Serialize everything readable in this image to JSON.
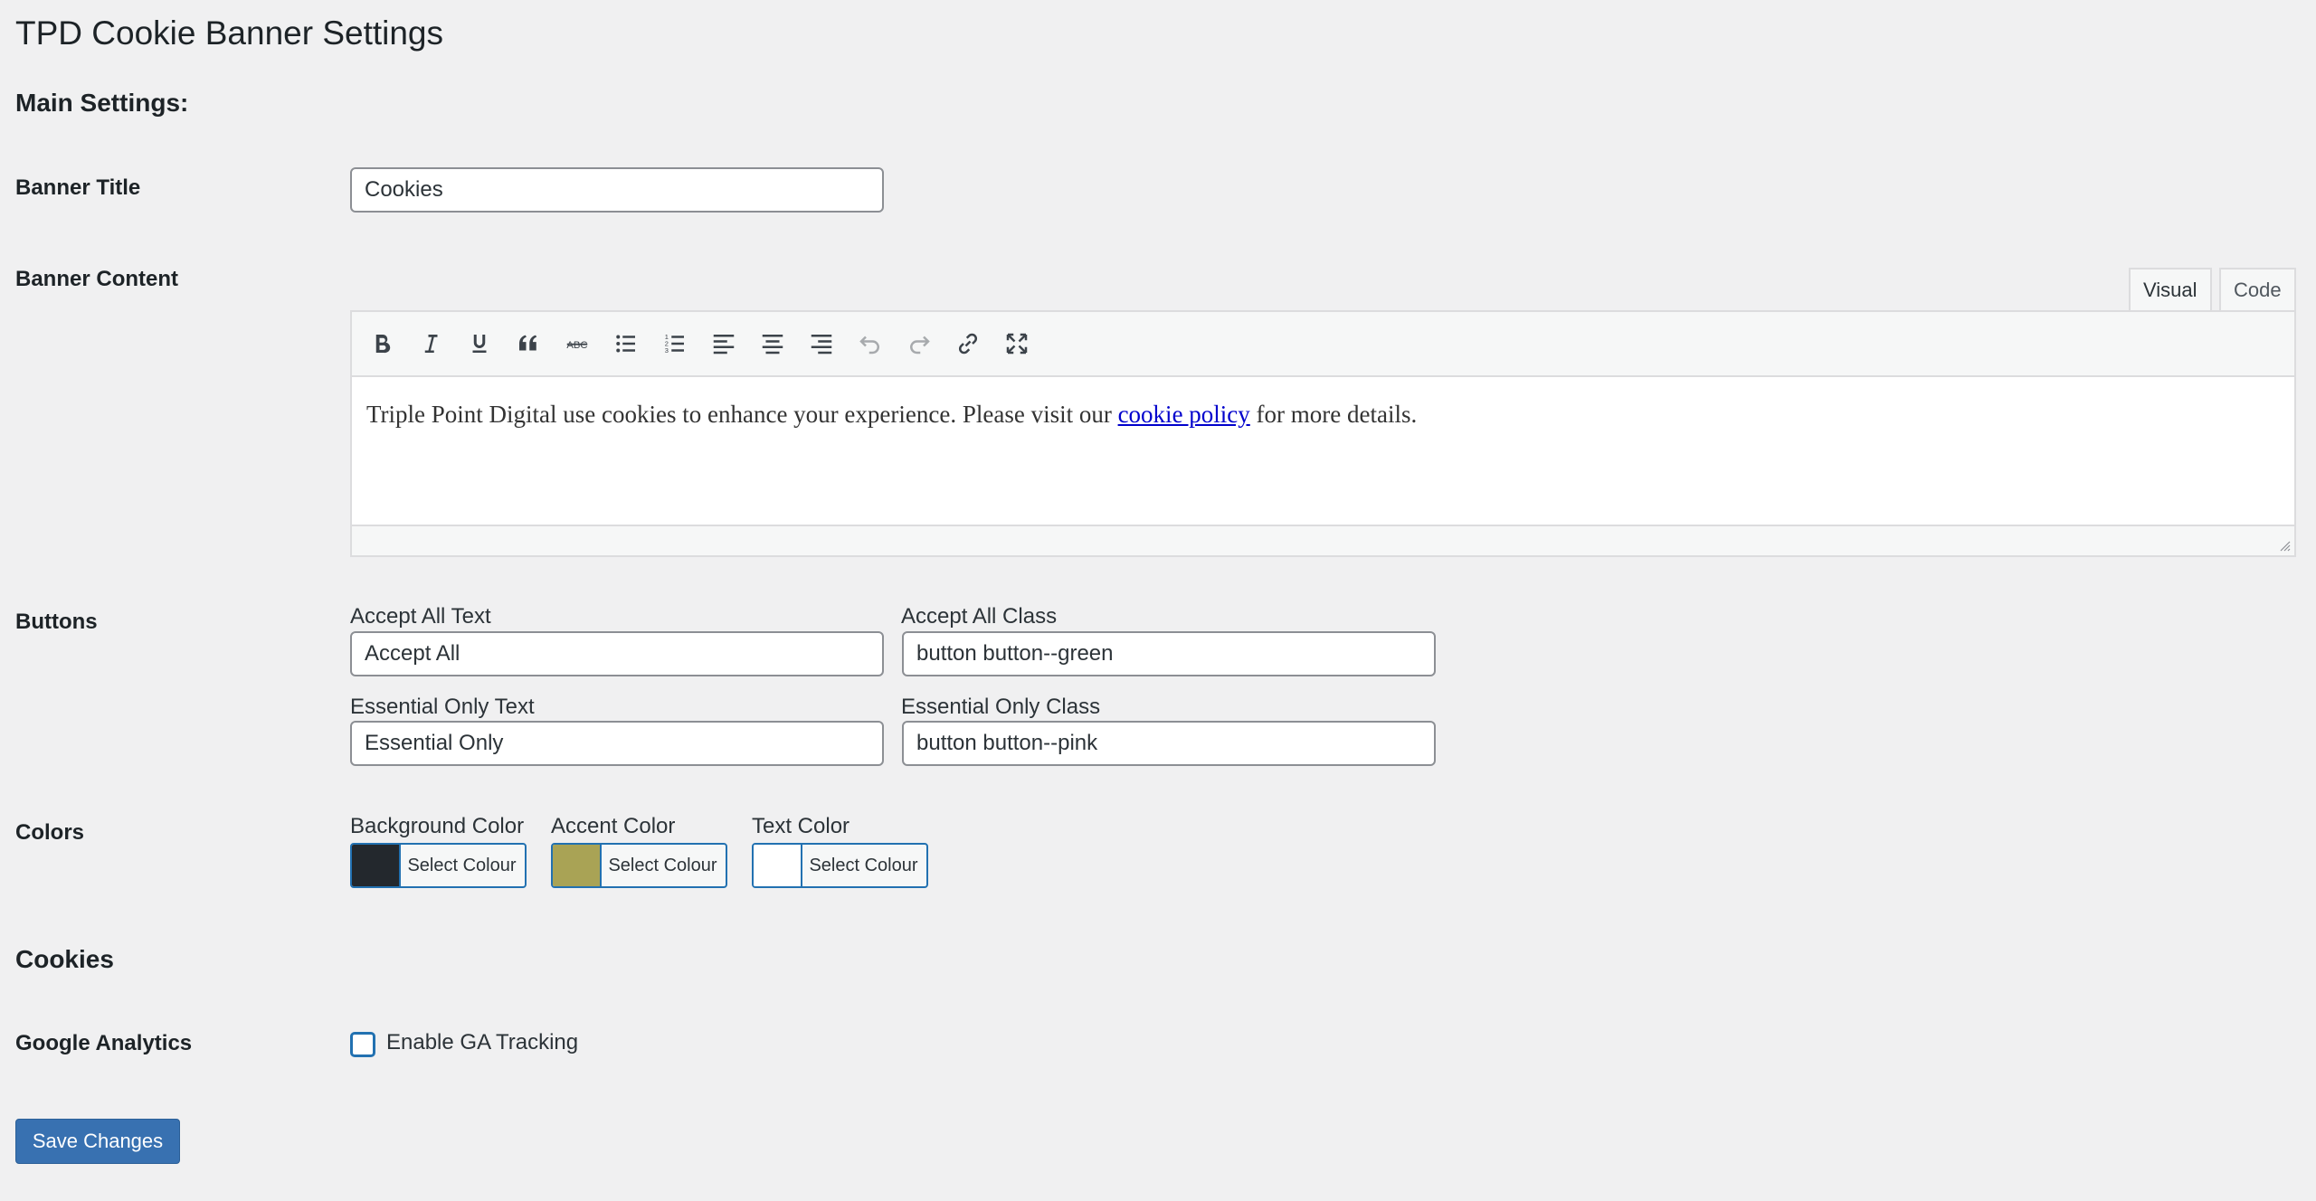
{
  "page": {
    "title": "TPD Cookie Banner Settings",
    "main_settings_heading": "Main Settings:",
    "cookies_heading": "Cookies"
  },
  "banner_title": {
    "label": "Banner Title",
    "value": "Cookies"
  },
  "banner_content": {
    "label": "Banner Content",
    "tabs": [
      "Visual",
      "Code"
    ],
    "active_tab": "Visual",
    "toolbar": [
      "bold-icon",
      "italic-icon",
      "underline-icon",
      "blockquote-icon",
      "strikethrough-icon",
      "bullet-list-icon",
      "numbered-list-icon",
      "align-left-icon",
      "align-center-icon",
      "align-right-icon",
      "undo-icon",
      "redo-icon",
      "link-icon",
      "fullscreen-icon"
    ],
    "text_before": "Triple Point Digital use cookies to enhance your experience. Please visit our ",
    "link_text": "cookie policy",
    "text_after": " for more details."
  },
  "buttons": {
    "label": "Buttons",
    "accept_all_text_label": "Accept All Text",
    "accept_all_text_value": "Accept All",
    "accept_all_class_label": "Accept All Class",
    "accept_all_class_value": "button button--green",
    "essential_only_text_label": "Essential Only Text",
    "essential_only_text_value": "Essential Only",
    "essential_only_class_label": "Essential Only Class",
    "essential_only_class_value": "button button--pink"
  },
  "colors": {
    "label": "Colors",
    "button_label": "Select Colour",
    "background": {
      "label": "Background Color",
      "color": "#23282d"
    },
    "accent": {
      "label": "Accent Color",
      "color": "#a9a355"
    },
    "text": {
      "label": "Text Color",
      "color": "#ffffff"
    }
  },
  "google_analytics": {
    "label": "Google Analytics",
    "checkbox_label": "Enable GA Tracking",
    "checked": false
  },
  "save_button": "Save Changes",
  "accent_color": "#2271b1"
}
